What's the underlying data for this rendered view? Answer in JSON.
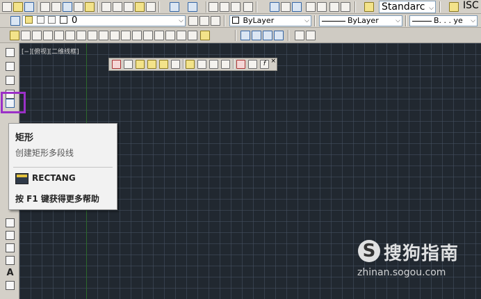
{
  "toolbar_top": {
    "text_style": "Standarc",
    "dim_style_prefix": "ISC"
  },
  "toolbar_layers": {
    "layer_name": "0",
    "color": "ByLayer",
    "linetype": "ByLayer",
    "lineweight": "B. . . ye"
  },
  "viewport": {
    "label": "[−][俯视][二维线框]"
  },
  "tooltip": {
    "title": "矩形",
    "description": "创建矩形多段线",
    "command": "RECTANG",
    "help": "按 F1 键获得更多帮助"
  },
  "watermark": {
    "logo_letter": "S",
    "brand": "搜狗指南",
    "url": "zhinan.sogou.com"
  },
  "floating_toolbar": {
    "close_glyph": "×"
  },
  "colors": {
    "canvas": "#212830",
    "grid": "#465262",
    "y_axis": "#2c6a2c",
    "toolbar": "#d4d0c8",
    "highlight": "#9b30c8"
  }
}
